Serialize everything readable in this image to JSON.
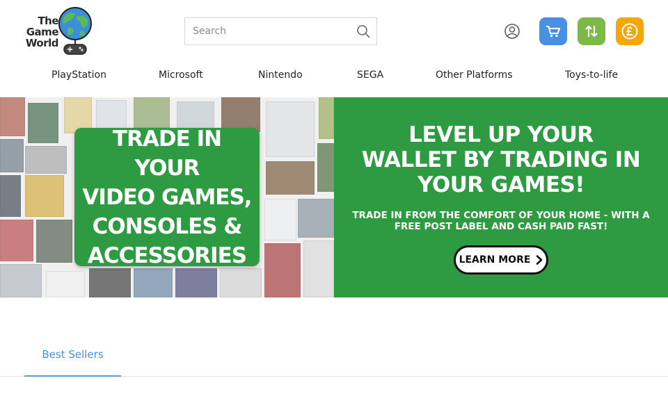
{
  "logo": {
    "line1": "The",
    "line2": "Game",
    "line3": "World"
  },
  "search": {
    "placeholder": "Search"
  },
  "header_buttons": {
    "account": "user-icon",
    "basket": "cart-icon",
    "sell_trade": "swap-arrows-icon",
    "currency": "pound-icon"
  },
  "colors": {
    "blue": "#4a90e2",
    "green": "#7cb84a",
    "orange": "#f5a70a",
    "banner_green": "#2e9a41",
    "tab_accent": "#4a90d9"
  },
  "nav": {
    "items": [
      "PlayStation",
      "Microsoft",
      "Nintendo",
      "SEGA",
      "Other Platforms",
      "Toys-to-life"
    ]
  },
  "banner": {
    "card_line1": "TRADE IN YOUR",
    "card_line2": "VIDEO GAMES,",
    "card_line3": "CONSOLES &",
    "card_line4": "ACCESSORIES",
    "title_line1": "LEVEL UP YOUR",
    "title_line2": "WALLET BY TRADING IN",
    "title_line3": "YOUR GAMES!",
    "subtitle_line1": "TRADE IN FROM THE COMFORT OF YOUR HOME - WITH A",
    "subtitle_line2": "FREE POST LABEL AND CASH PAID FAST!",
    "button_label": "LEARN MORE"
  },
  "tabs": {
    "active": "Best Sellers"
  }
}
